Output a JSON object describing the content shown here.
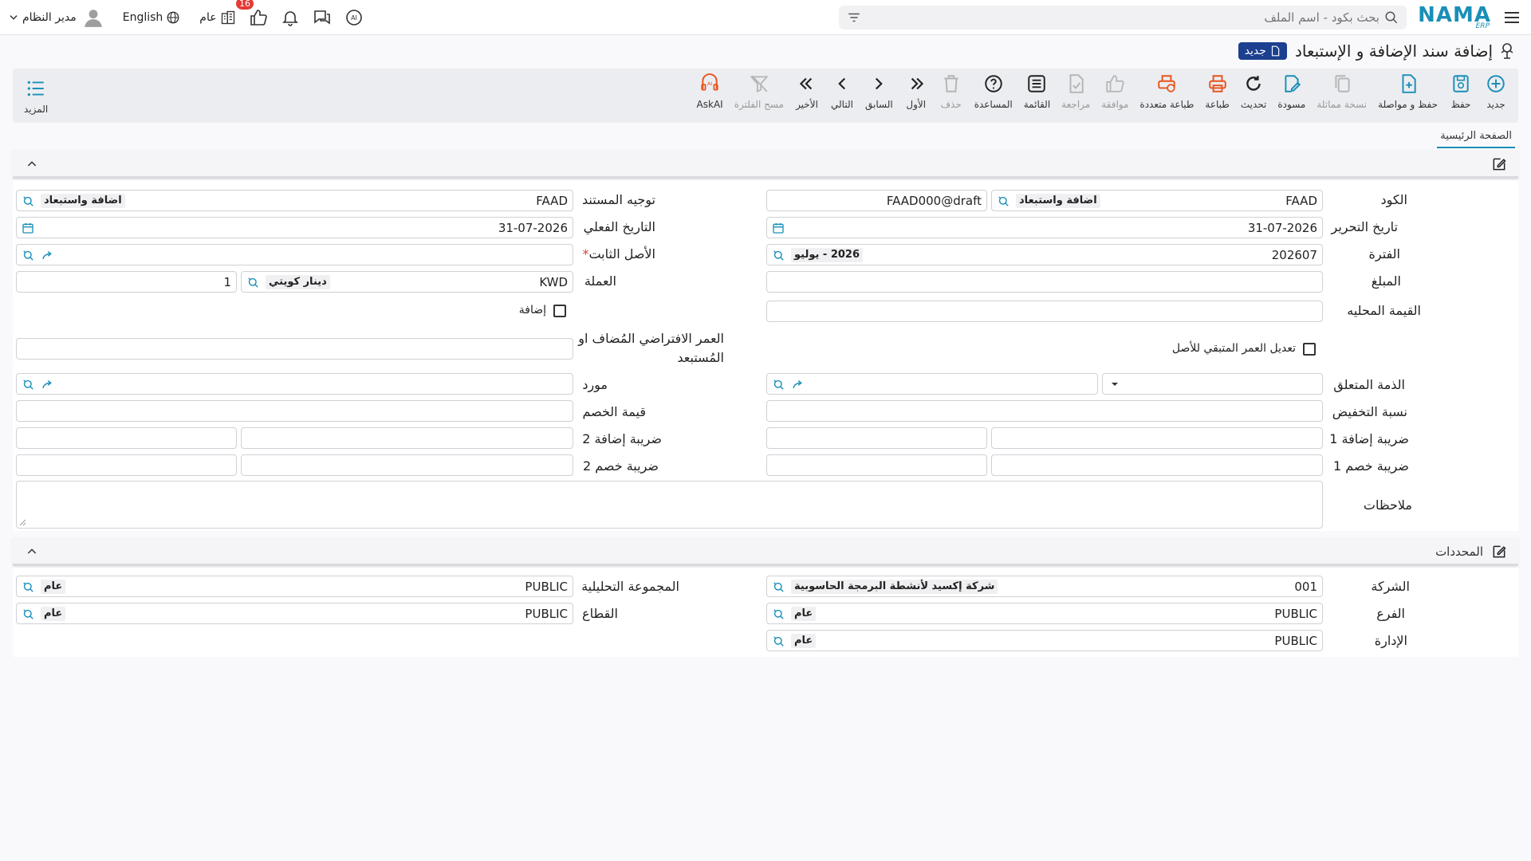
{
  "topbar": {
    "logo_text": "NAMA",
    "logo_sub": "ERP",
    "search_placeholder": "بحث بكود - اسم الملف",
    "user_name": "مدير النظام",
    "language": "English",
    "context": "عام",
    "notification_count": "16"
  },
  "title": {
    "text": "إضافة سند الإضافة و الإستبعاد",
    "badge": "جديد"
  },
  "toolbar": {
    "items": [
      {
        "label": "جديد",
        "icon": "add-circle-icon"
      },
      {
        "label": "حفظ",
        "icon": "save-icon"
      },
      {
        "label": "حفظ و مواصلة",
        "icon": "save-continue-icon"
      },
      {
        "label": "نسخة مماثلة",
        "icon": "copy-icon"
      },
      {
        "label": "مسودة",
        "icon": "draft-icon"
      },
      {
        "label": "تحديث",
        "icon": "refresh-icon"
      },
      {
        "label": "طباعة",
        "icon": "print-icon"
      },
      {
        "label": "طباعة متعددة",
        "icon": "multi-print-icon"
      },
      {
        "label": "موافقة",
        "icon": "approve-icon"
      },
      {
        "label": "مراجعة",
        "icon": "review-icon"
      },
      {
        "label": "القائمة",
        "icon": "list-icon"
      },
      {
        "label": "المساعدة",
        "icon": "help-icon"
      },
      {
        "label": "حذف",
        "icon": "delete-icon"
      },
      {
        "label": "الأول",
        "icon": "first-icon"
      },
      {
        "label": "السابق",
        "icon": "previous-icon"
      },
      {
        "label": "التالي",
        "icon": "next-icon"
      },
      {
        "label": "الأخير",
        "icon": "last-icon"
      },
      {
        "label": "مسح الفلترة",
        "icon": "clear-filter-icon"
      },
      {
        "label": "AskAI",
        "icon": "ask-ai-icon"
      }
    ],
    "more_label": "المزيد"
  },
  "tabs": {
    "main": "الصفحة الرئيسية"
  },
  "sections": {
    "dimensions": "المحددات"
  },
  "form": {
    "code_label": "الكود",
    "code_value": "FAAD",
    "code_desc": "اضافة واستبعاد",
    "code_number": "FAAD000@draft",
    "doc_direction_label": "توجيه المستند",
    "doc_direction_value": "FAAD",
    "doc_direction_desc": "اضافة واستبعاد",
    "edit_date_label": "تاريخ التحرير",
    "edit_date_value": "31-07-2026",
    "actual_date_label": "التاريخ الفعلي",
    "actual_date_value": "31-07-2026",
    "period_label": "الفترة",
    "period_value": "202607",
    "period_desc": "2026 - يوليو",
    "fixed_asset_label": "الأصل الثابت",
    "amount_label": "المبلغ",
    "currency_label": "العملة",
    "currency_value": "KWD",
    "currency_desc": "دينار كويتي",
    "currency_rate": "1",
    "local_value_label": "القيمة المحليه",
    "addition_label": "إضافة",
    "adjust_life_label": "تعديل العمر المتبقي للأصل",
    "virtual_life_label": "العمر الافتراضي المُضاف او المُستبعد",
    "related_account_label": "الذمة المتعلق",
    "supplier_label": "مورد",
    "discount_rate_label": "نسبة التخفيض",
    "discount_value_label": "قيمة الخصم",
    "tax_add1_label": "ضريبة إضافة 1",
    "tax_add2_label": "ضريبة إضافة 2",
    "tax_ded1_label": "ضريبة خصم 1",
    "tax_ded2_label": "ضريبة خصم 2",
    "notes_label": "ملاحظات"
  },
  "dims": {
    "company_label": "الشركة",
    "company_value": "001",
    "company_desc": "شركة إكسيد لأنشطة البرمجة الحاسوبية",
    "analytic_label": "المجموعة التحليلية",
    "analytic_value": "PUBLIC",
    "analytic_desc": "عام",
    "branch_label": "الفرع",
    "branch_value": "PUBLIC",
    "branch_desc": "عام",
    "sector_label": "القطاع",
    "sector_value": "PUBLIC",
    "sector_desc": "عام",
    "dept_label": "الإدارة",
    "dept_value": "PUBLIC",
    "dept_desc": "عام"
  },
  "colors": {
    "accent": "#1a8fb8",
    "badge": "#1c3f8f",
    "print": "#e8531e",
    "danger": "#e53935"
  }
}
